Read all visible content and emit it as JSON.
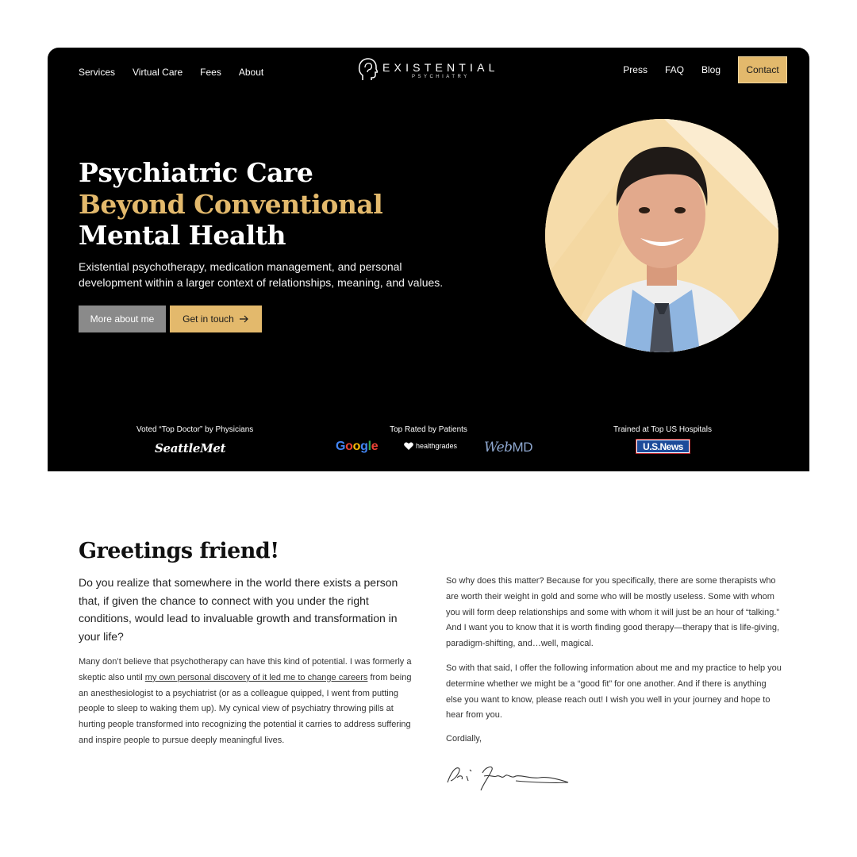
{
  "nav": {
    "left": [
      "Services",
      "Virtual Care",
      "Fees",
      "About"
    ],
    "right": [
      "Press",
      "FAQ",
      "Blog"
    ],
    "contact": "Contact"
  },
  "brand": {
    "name": "EXISTENTIAL",
    "sub": "PSYCHIATRY"
  },
  "hero": {
    "headline_1": "Psychiatric Care",
    "headline_2": "Beyond Conventional",
    "headline_3": "Mental Health",
    "description": "Existential psychotherapy, medication management, and personal development within a larger context of relationships, meaning, and values.",
    "btn_more": "More about me",
    "btn_touch": "Get in touch"
  },
  "badges": {
    "voted": "Voted “Top Doctor” by Physicians",
    "rated": "Top Rated by Patients",
    "trained": "Trained at Top US Hospitals",
    "seattlemet": "SeattleMet",
    "google": "Google",
    "healthgrades": "healthgrades",
    "webmd_web": "Web",
    "webmd_md": "MD",
    "usnews": "U.S.News"
  },
  "body": {
    "greeting": "Greetings friend!",
    "lead": "Do you realize that somewhere in the world there exists a person that, if given the chance to connect with you under the right conditions, would lead to invaluable growth and transformation in your life?",
    "p1_before": "Many don’t believe that psychotherapy can have this kind of potential. I was formerly a skeptic also until ",
    "p1_link": "my own personal discovery of it led me to change careers",
    "p1_after": " from being an anesthesiologist to a psychiatrist (or as a colleague quipped, I went from putting people to sleep to waking them up). My cynical view of psychiatry throwing pills at hurting people transformed into recognizing the potential it carries to address suffering and inspire people to pursue deeply meaningful lives.",
    "p2": "So why does this matter? Because for you specifically, there are some therapists who are worth their weight in gold and some who will be mostly useless. Some with whom you will form deep relationships and some with whom it will just be an hour of “talking.” And I want you to know that it is worth finding good therapy—therapy that is life-giving, paradigm-shifting, and…well, magical.",
    "p3": "So with that said, I offer the following information about me and my practice to help you determine whether we might be a “good fit” for one another. And if there is anything else you want to know, please reach out! I wish you well in your journey and hope to hear from you.",
    "closing": "Cordially,"
  },
  "colors": {
    "gold": "#e3b96c",
    "hero_bg": "#000000",
    "gray_button": "#8a8a8a"
  },
  "icons": [
    "head-silhouette-logo-icon",
    "arrow-right-icon",
    "heart-icon"
  ]
}
